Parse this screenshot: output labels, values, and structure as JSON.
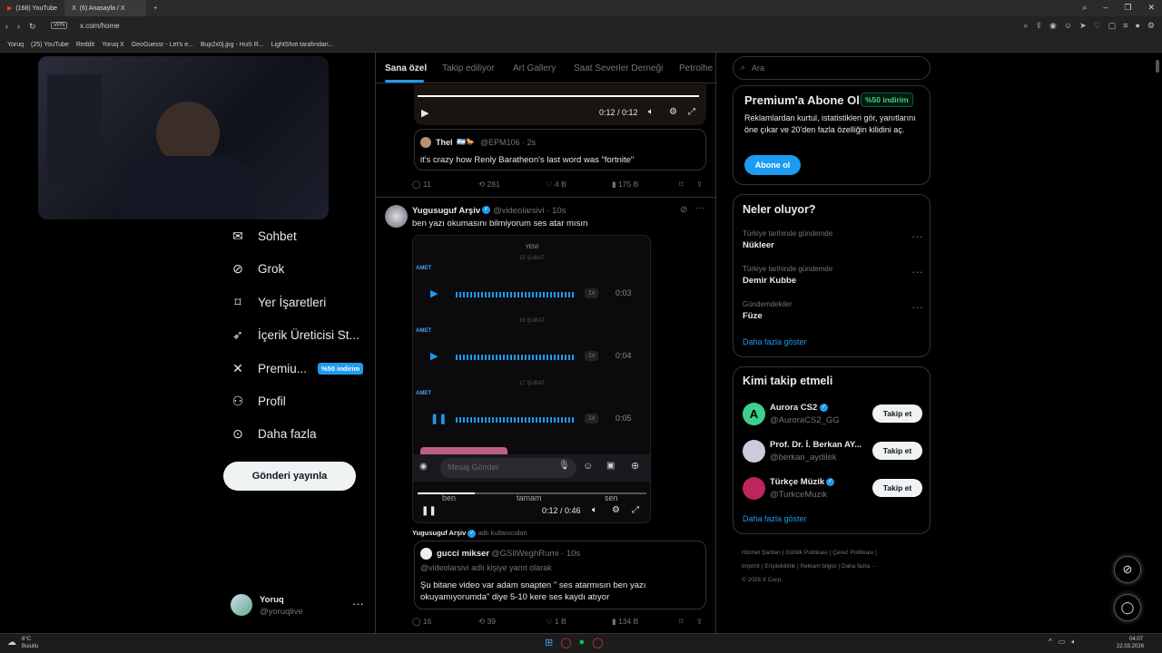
{
  "browser": {
    "tabs": [
      "(168) YouTube",
      "(6) Anasayfa / X"
    ],
    "url": "x.com/home",
    "vpn": "VPN",
    "bookmarks": [
      "Yoruq",
      "(25) YouTube",
      "Reddit",
      "Yoruq X",
      "GeoGuessr - Let's e...",
      "Bup2x0j.jpg - Hızlı R...",
      "LightShot tarafından..."
    ]
  },
  "nav": {
    "items": [
      "Sohbet",
      "Grok",
      "Yer İşaretleri",
      "İçerik Üreticisi St...",
      "Premiu...",
      "Profil",
      "Daha fazla"
    ],
    "premium_badge": "%50 indirim",
    "post_label": "Gönderi yayınla",
    "account_name": "Yoruq",
    "account_handle": "@yoruqlive",
    "more": "···"
  },
  "tabs": [
    "Sana özel",
    "Takip ediliyor",
    "Art Gallery",
    "Saat Severler Derneği",
    "Petrolhe"
  ],
  "post1": {
    "video_time": "0:12 / 0:12",
    "quote_name": "Thel",
    "quote_handle": "@EPM106 · 2s",
    "quote_text": "it's crazy how Renly Baratheon's last word was \"fortnite\"",
    "replies": "11",
    "reposts": "281",
    "likes": "4 B",
    "views": "175 B"
  },
  "post2": {
    "name": "Yugusuguf Arşiv",
    "handle": "@videolarsivi · 10s",
    "text": "ben yazı okumasını bilmiyorum ses atar mısın",
    "video": {
      "header": "YENİ",
      "dates": [
        "15 ŞUBAT",
        "16 ŞUBAT",
        "17 ŞUBAT"
      ],
      "sender": "AMET",
      "durations": [
        "0:03",
        "0:04",
        "0:05"
      ],
      "speed": "1x",
      "placeholder": "Mesaj Gönder",
      "subtitles": [
        "ben",
        "tamam",
        "sen"
      ],
      "time": "0:12 / 0:46"
    },
    "byline_name": "Yugusuguf Arşiv",
    "byline_note": "adlı kullanıcıdan",
    "quote_name": "gucci mikser",
    "quote_handle": "@GSllWeghRumi · 10s",
    "quote_reply": "@videolarsivi adlı kişiye yanıt olarak",
    "quote_text": "Şu bitane video var adam snapten \" ses atarmısın ben yazı okuyamıyorumda\" diye 5-10 kere ses kaydı atıyor",
    "replies": "16",
    "reposts": "39",
    "likes": "1 B",
    "views": "134 B"
  },
  "right": {
    "search_placeholder": "Ara",
    "premium": {
      "title": "Premium'a Abone Ol",
      "badge": "%50 indirim",
      "text": "Reklamlardan kurtul, istatistikleri gör, yanıtlarını öne çıkar ve 20'den fazla özelliğin kilidini aç.",
      "button": "Abone ol"
    },
    "trends": {
      "title": "Neler oluyor?",
      "items": [
        {
          "context": "Türkiye tarihinde gündemde",
          "name": "Nükleer"
        },
        {
          "context": "Türkiye tarihinde gündemde",
          "name": "Demir Kubbe"
        },
        {
          "context": "Gündemdekiler",
          "name": "Füze"
        }
      ],
      "more": "Daha fazla göster"
    },
    "follow": {
      "title": "Kimi takip etmeli",
      "items": [
        {
          "name": "Aurora CS2",
          "handle": "@AuroraCS2_GG",
          "button": "Takip et"
        },
        {
          "name": "Prof. Dr. İ. Berkan AY...",
          "handle": "@berkan_aydilek",
          "button": "Takip et"
        },
        {
          "name": "Türkçe Müzik",
          "handle": "@TurkceMuzik",
          "button": "Takip et"
        }
      ],
      "more": "Daha fazla göster"
    },
    "footer": [
      "Hizmet Şartları",
      "Gizlilik Politikası",
      "Çerez Politikası",
      "Imprint",
      "Erişilebilirlik",
      "Reklam bilgisi",
      "Daha fazla ···",
      "© 2026 X Corp."
    ]
  },
  "taskbar": {
    "weather_temp": "6°C",
    "weather_text": "Bulutlu",
    "time": "04:07",
    "date": "22.03.2026"
  }
}
